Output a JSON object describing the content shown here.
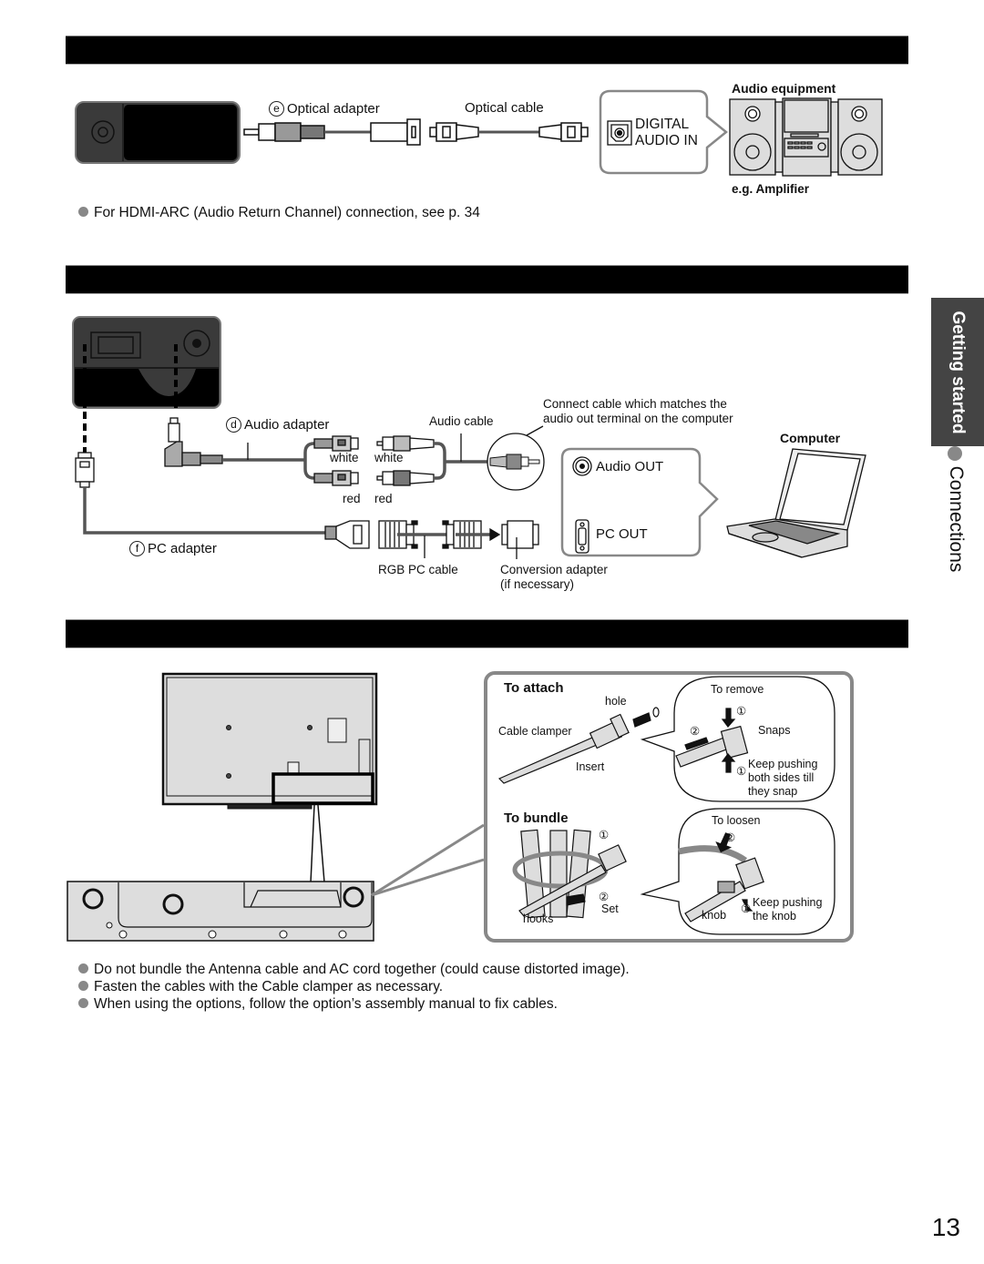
{
  "section_bars": [
    {
      "label": ""
    },
    {
      "label": ""
    },
    {
      "label": ""
    }
  ],
  "side_tab": {
    "section": "Getting started",
    "topic": "Connections"
  },
  "optical": {
    "adapter_marker": "e",
    "adapter_label": "Optical adapter",
    "cable_label": "Optical cable",
    "terminal_line1": "DIGITAL",
    "terminal_line2": "AUDIO IN",
    "device_title": "Audio equipment",
    "device_caption": "e.g. Amplifier",
    "note": "For HDMI-ARC (Audio Return Channel) connection, see p. 34"
  },
  "pc": {
    "audio_adapter_marker": "d",
    "audio_adapter_label": "Audio adapter",
    "audio_cable_label": "Audio cable",
    "match_note_line1": "Connect cable which matches the",
    "match_note_line2": "audio out terminal on the computer",
    "white_left": "white",
    "white_right": "white",
    "red_left": "red",
    "red_right": "red",
    "pc_adapter_marker": "f",
    "pc_adapter_label": "PC adapter",
    "rgb_cable_label": "RGB PC cable",
    "conversion_label_line1": "Conversion adapter",
    "conversion_label_line2": "(if necessary)",
    "audio_out_label": "Audio OUT",
    "pc_out_label": "PC OUT",
    "device_title": "Computer"
  },
  "clamper": {
    "attach_title": "To attach",
    "hole_label": "hole",
    "cable_clamper_label": "Cable clamper",
    "insert_label": "Insert",
    "remove_title": "To remove",
    "step1": "①",
    "step2": "②",
    "snaps_label": "Snaps",
    "keep_pushing_line1": "Keep pushing",
    "keep_pushing_line2": "both sides till",
    "keep_pushing_line3": "they snap",
    "bundle_title": "To bundle",
    "set_label": "Set",
    "hooks_label": "hooks",
    "loosen_title": "To loosen",
    "knob_label": "knob",
    "keep_knob_line1": "Keep pushing",
    "keep_knob_line2": "the knob"
  },
  "notes": [
    "Do not bundle the Antenna cable and AC cord together (could cause distorted image).",
    "Fasten the cables with the Cable clamper as necessary.",
    "When using the options, follow the option’s assembly manual to fix cables."
  ],
  "page_number": "13"
}
